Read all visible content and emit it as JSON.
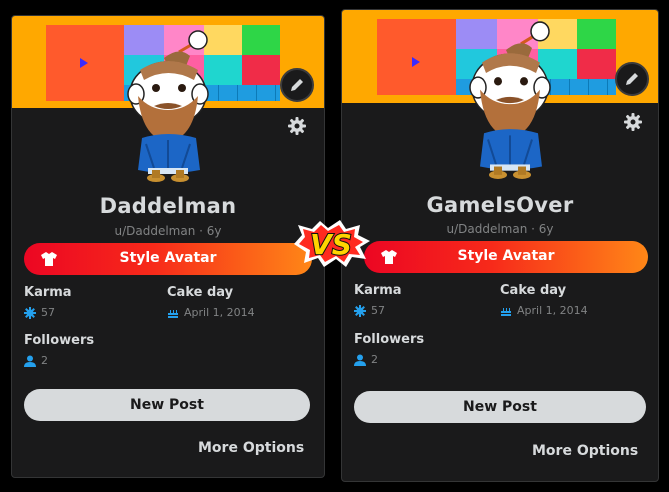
{
  "cards": [
    {
      "display_name": "Daddelman",
      "username_line": "u/Daddelman · 6y",
      "style_button_label": "Style Avatar",
      "karma_label": "Karma",
      "karma_value": "57",
      "cakeday_label": "Cake day",
      "cakeday_value": "April 1, 2014",
      "followers_label": "Followers",
      "followers_value": "2",
      "new_post_label": "New Post",
      "more_options_label": "More Options"
    },
    {
      "display_name": "GameIsOver",
      "username_line": "u/Daddelman · 6y",
      "style_button_label": "Style Avatar",
      "karma_label": "Karma",
      "karma_value": "57",
      "cakeday_label": "Cake day",
      "cakeday_value": "April 1, 2014",
      "followers_label": "Followers",
      "followers_value": "2",
      "new_post_label": "New Post",
      "more_options_label": "More Options"
    }
  ],
  "vs_badge_text": "VS",
  "colors": {
    "background": "#000000",
    "card": "#1a1a1b",
    "banner": "#ffa800",
    "text_primary": "#d7dadc",
    "text_secondary": "#818384",
    "style_gradient_start": "#ec0623",
    "style_gradient_end": "#ff8717",
    "karma_icon": "#24a0ed",
    "vs_yellow": "#ffd400",
    "vs_red": "#ff2a1f"
  },
  "icons": [
    "play-icon",
    "pencil-icon",
    "gear-icon",
    "shirt-icon",
    "karma-icon",
    "cake-icon",
    "user-icon"
  ]
}
